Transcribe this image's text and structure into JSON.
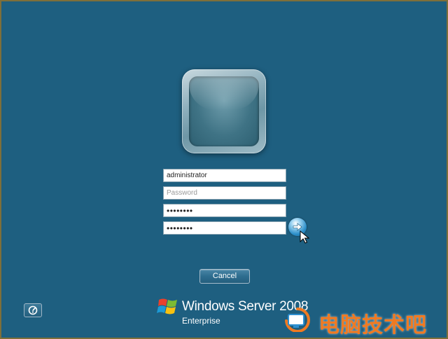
{
  "login": {
    "username_value": "administrator",
    "password_placeholder": "Password",
    "new_password_mask": "••••••••",
    "confirm_password_mask": "••••••••"
  },
  "actions": {
    "cancel_label": "Cancel",
    "submit_icon": "arrow-right-icon",
    "accessibility_icon": "ease-of-access-icon"
  },
  "branding": {
    "product": "Windows Server 2008",
    "edition": "Enterprise",
    "logo_icon": "windows-flag-icon"
  },
  "watermark": {
    "text": "电脑技术吧"
  },
  "colors": {
    "background": "#1e5f80",
    "border": "#7e6f3a",
    "watermark": "#f07a22"
  }
}
